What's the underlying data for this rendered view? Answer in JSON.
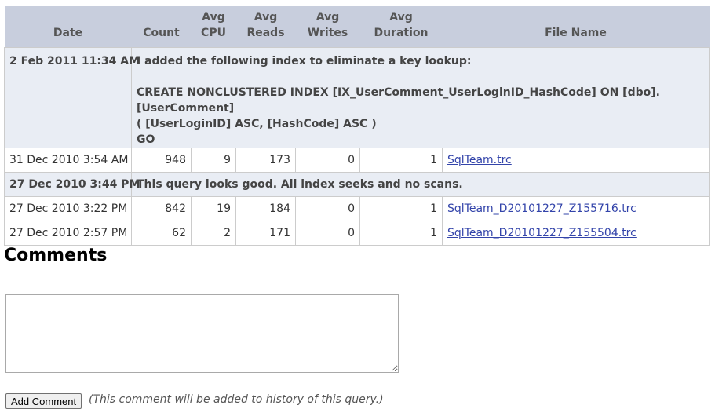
{
  "table": {
    "headers": {
      "date": "Date",
      "count": "Count",
      "avg_cpu": [
        "Avg",
        "CPU"
      ],
      "avg_reads": [
        "Avg",
        "Reads"
      ],
      "avg_writes": [
        "Avg",
        "Writes"
      ],
      "avg_duration": [
        "Avg",
        "Duration"
      ],
      "file_name": "File Name"
    },
    "note1": {
      "date": "2 Feb 2011 11:34 AM",
      "line1": "I added the following index to eliminate a key lookup:",
      "line2": "CREATE NONCLUSTERED INDEX [IX_UserComment_UserLoginID_HashCode] ON [dbo].[UserComment]",
      "line3": "( [UserLoginID] ASC, [HashCode] ASC )",
      "line4": "GO"
    },
    "row1": {
      "date": "31 Dec 2010 3:54 AM",
      "count": "948",
      "cpu": "9",
      "reads": "173",
      "writes": "0",
      "duration": "1",
      "file": "SqlTeam.trc"
    },
    "note2": {
      "date": "27 Dec 2010 3:44 PM",
      "text": "This query looks good. All index seeks and no scans."
    },
    "row2": {
      "date": "27 Dec 2010 3:22 PM",
      "count": "842",
      "cpu": "19",
      "reads": "184",
      "writes": "0",
      "duration": "1",
      "file": "SqlTeam_D20101227_Z155716.trc"
    },
    "row3": {
      "date": "27 Dec 2010 2:57 PM",
      "count": "62",
      "cpu": "2",
      "reads": "171",
      "writes": "0",
      "duration": "1",
      "file": "SqlTeam_D20101227_Z155504.trc"
    }
  },
  "comments": {
    "title": "Comments",
    "textarea_value": "",
    "button_label": "Add Comment",
    "hint": "(This comment will be added to history of this query.)"
  }
}
